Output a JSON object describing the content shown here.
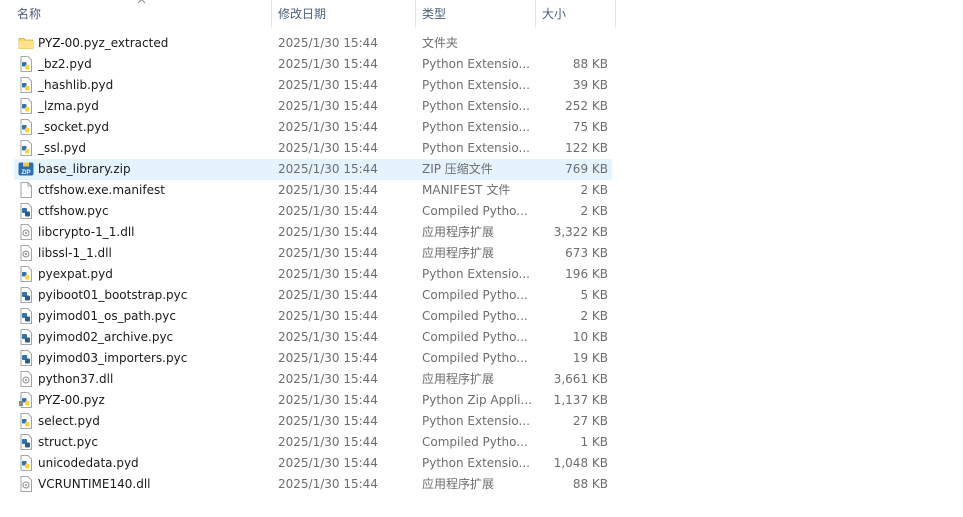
{
  "columns": {
    "name": "名称",
    "date": "修改日期",
    "type": "类型",
    "size": "大小"
  },
  "files": [
    {
      "name": "PYZ-00.pyz_extracted",
      "date": "2025/1/30 15:44",
      "type": "文件夹",
      "size": "",
      "icon": "folder-icon"
    },
    {
      "name": "_bz2.pyd",
      "date": "2025/1/30 15:44",
      "type": "Python Extensio...",
      "size": "88 KB",
      "icon": "python-file-icon"
    },
    {
      "name": "_hashlib.pyd",
      "date": "2025/1/30 15:44",
      "type": "Python Extensio...",
      "size": "39 KB",
      "icon": "python-file-icon"
    },
    {
      "name": "_lzma.pyd",
      "date": "2025/1/30 15:44",
      "type": "Python Extensio...",
      "size": "252 KB",
      "icon": "python-file-icon"
    },
    {
      "name": "_socket.pyd",
      "date": "2025/1/30 15:44",
      "type": "Python Extensio...",
      "size": "75 KB",
      "icon": "python-file-icon"
    },
    {
      "name": "_ssl.pyd",
      "date": "2025/1/30 15:44",
      "type": "Python Extensio...",
      "size": "122 KB",
      "icon": "python-file-icon"
    },
    {
      "name": "base_library.zip",
      "date": "2025/1/30 15:44",
      "type": "ZIP 压缩文件",
      "size": "769 KB",
      "icon": "zip-file-icon",
      "selected": true
    },
    {
      "name": "ctfshow.exe.manifest",
      "date": "2025/1/30 15:44",
      "type": "MANIFEST 文件",
      "size": "2 KB",
      "icon": "blank-file-icon"
    },
    {
      "name": "ctfshow.pyc",
      "date": "2025/1/30 15:44",
      "type": "Compiled Pytho...",
      "size": "2 KB",
      "icon": "compiled-python-icon"
    },
    {
      "name": "libcrypto-1_1.dll",
      "date": "2025/1/30 15:44",
      "type": "应用程序扩展",
      "size": "3,322 KB",
      "icon": "dll-file-icon"
    },
    {
      "name": "libssl-1_1.dll",
      "date": "2025/1/30 15:44",
      "type": "应用程序扩展",
      "size": "673 KB",
      "icon": "dll-file-icon"
    },
    {
      "name": "pyexpat.pyd",
      "date": "2025/1/30 15:44",
      "type": "Python Extensio...",
      "size": "196 KB",
      "icon": "python-file-icon"
    },
    {
      "name": "pyiboot01_bootstrap.pyc",
      "date": "2025/1/30 15:44",
      "type": "Compiled Pytho...",
      "size": "5 KB",
      "icon": "compiled-python-icon"
    },
    {
      "name": "pyimod01_os_path.pyc",
      "date": "2025/1/30 15:44",
      "type": "Compiled Pytho...",
      "size": "2 KB",
      "icon": "compiled-python-icon"
    },
    {
      "name": "pyimod02_archive.pyc",
      "date": "2025/1/30 15:44",
      "type": "Compiled Pytho...",
      "size": "10 KB",
      "icon": "compiled-python-icon"
    },
    {
      "name": "pyimod03_importers.pyc",
      "date": "2025/1/30 15:44",
      "type": "Compiled Pytho...",
      "size": "19 KB",
      "icon": "compiled-python-icon"
    },
    {
      "name": "python37.dll",
      "date": "2025/1/30 15:44",
      "type": "应用程序扩展",
      "size": "3,661 KB",
      "icon": "dll-file-icon"
    },
    {
      "name": "PYZ-00.pyz",
      "date": "2025/1/30 15:44",
      "type": "Python Zip Appli...",
      "size": "1,137 KB",
      "icon": "python-zip-icon"
    },
    {
      "name": "select.pyd",
      "date": "2025/1/30 15:44",
      "type": "Python Extensio...",
      "size": "27 KB",
      "icon": "python-file-icon"
    },
    {
      "name": "struct.pyc",
      "date": "2025/1/30 15:44",
      "type": "Compiled Pytho...",
      "size": "1 KB",
      "icon": "compiled-python-icon"
    },
    {
      "name": "unicodedata.pyd",
      "date": "2025/1/30 15:44",
      "type": "Python Extensio...",
      "size": "1,048 KB",
      "icon": "python-file-icon"
    },
    {
      "name": "VCRUNTIME140.dll",
      "date": "2025/1/30 15:44",
      "type": "应用程序扩展",
      "size": "88 KB",
      "icon": "dll-file-icon"
    }
  ],
  "colors": {
    "header_text": "#4c607a",
    "secondary_text": "#6d6d6d",
    "selection": "#e5f3ff",
    "folder": "#f8d775",
    "python_blue": "#3572a5",
    "python_yellow": "#ffd43b"
  }
}
